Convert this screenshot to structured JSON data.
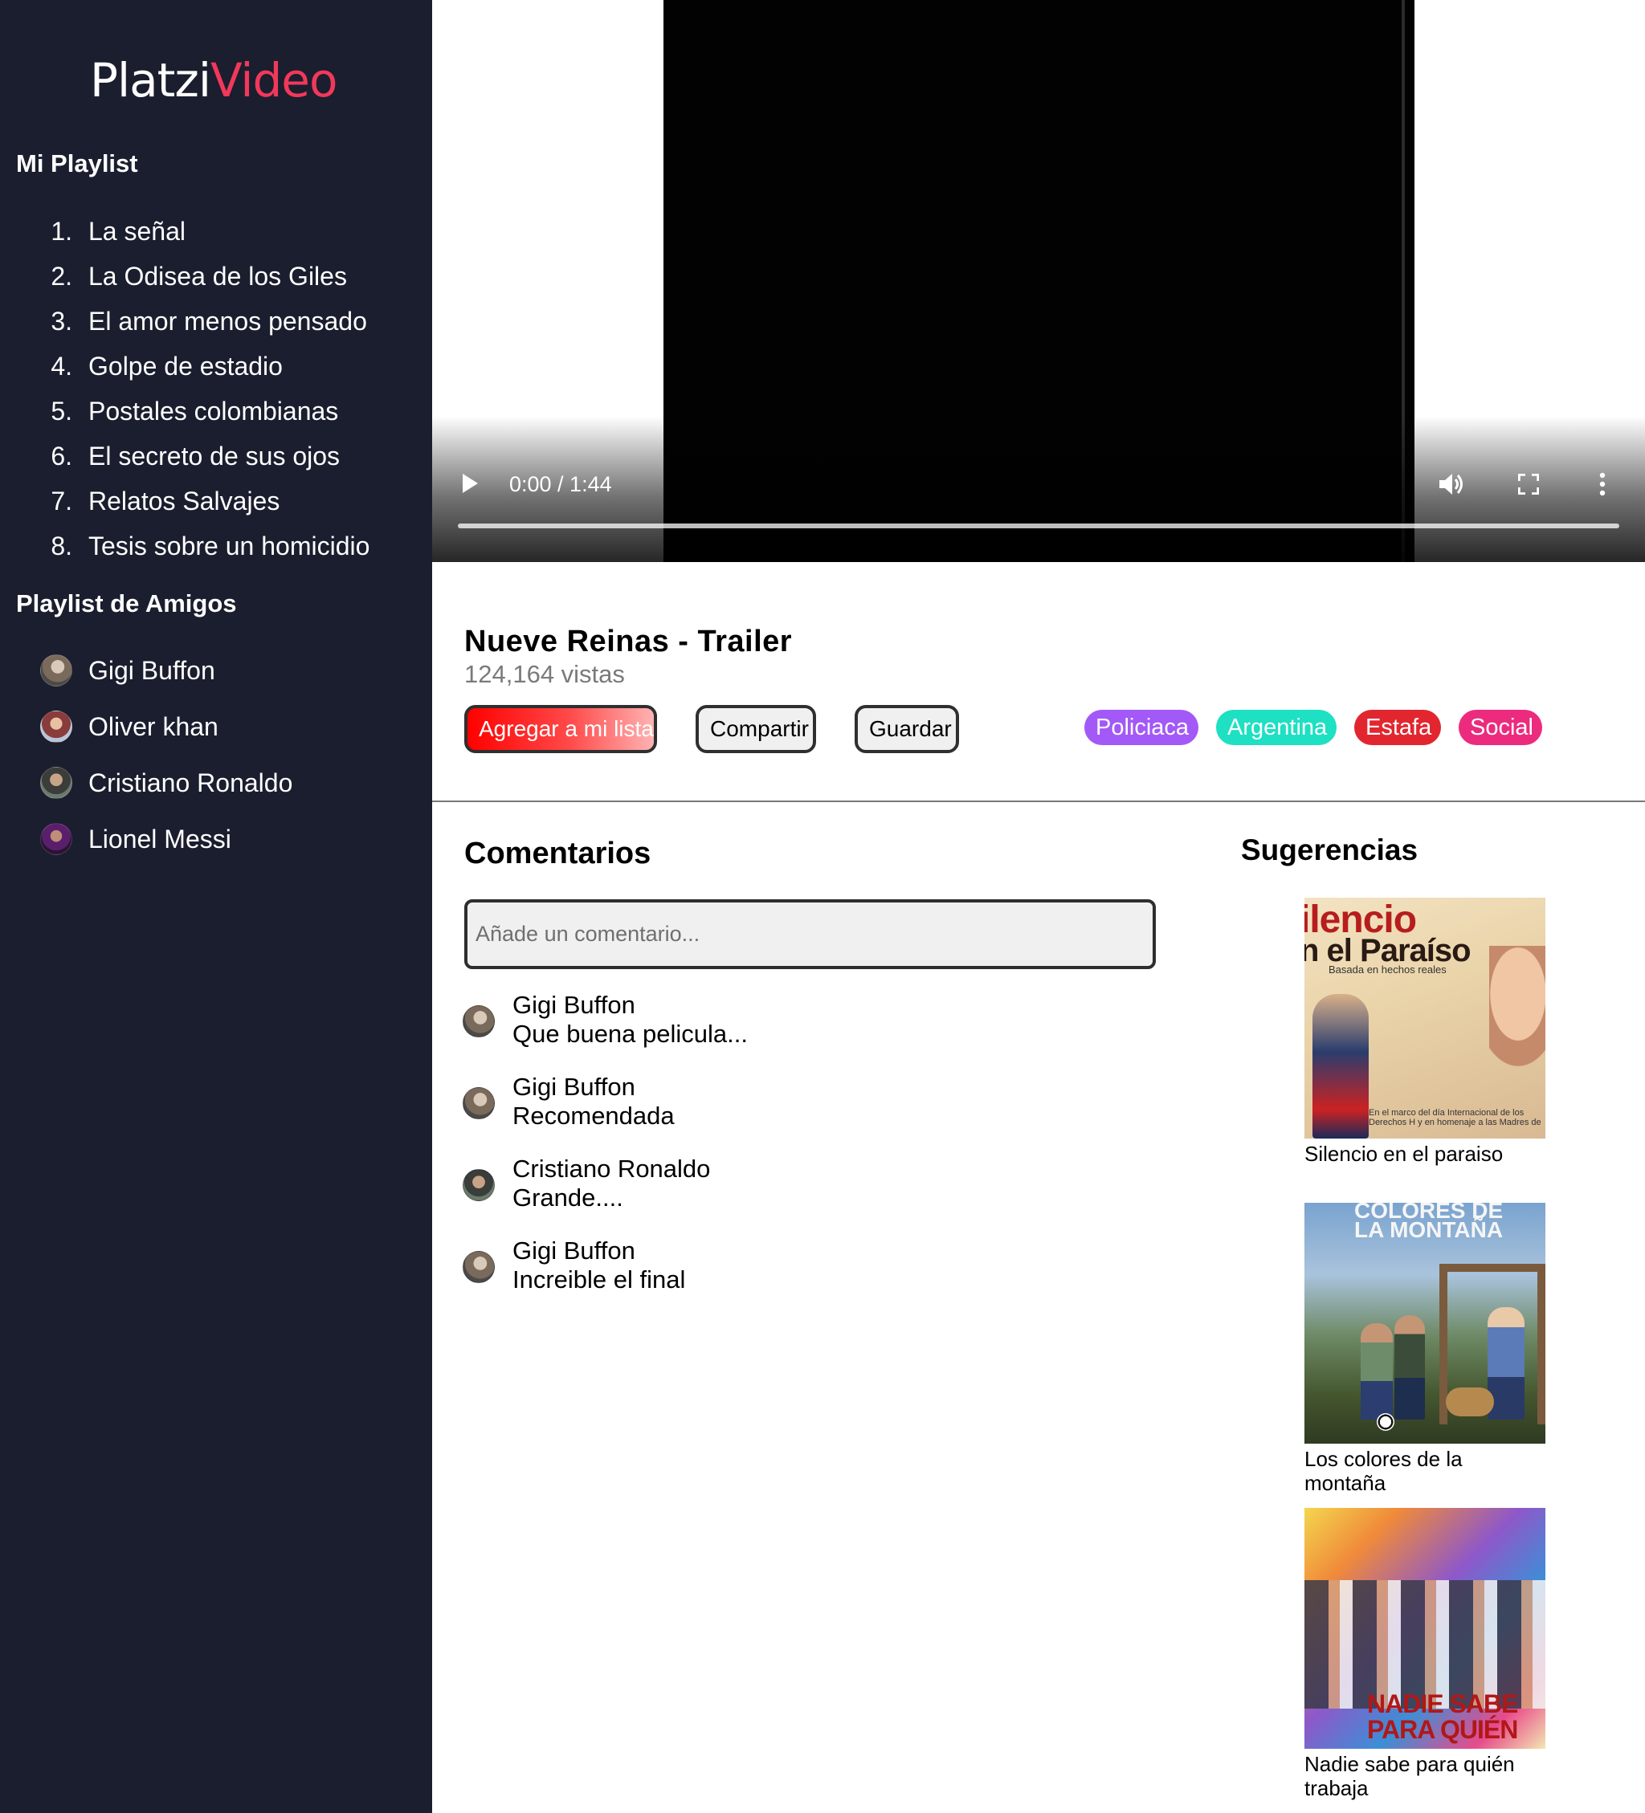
{
  "brand": {
    "part1": "Platzi",
    "part2": "Video"
  },
  "sidebar": {
    "playlist_title": "Mi Playlist",
    "playlist": [
      {
        "num": "1.",
        "title": "La señal"
      },
      {
        "num": "2.",
        "title": "La Odisea de los Giles"
      },
      {
        "num": "3.",
        "title": "El amor menos pensado"
      },
      {
        "num": "4.",
        "title": "Golpe de estadio"
      },
      {
        "num": "5.",
        "title": "Postales colombianas"
      },
      {
        "num": "6.",
        "title": "El secreto de sus ojos"
      },
      {
        "num": "7.",
        "title": "Relatos Salvajes"
      },
      {
        "num": "8.",
        "title": "Tesis sobre un homicidio"
      }
    ],
    "friends_title": "Playlist de Amigos",
    "friends": [
      {
        "name": "Gigi Buffon"
      },
      {
        "name": "Oliver khan"
      },
      {
        "name": "Cristiano Ronaldo"
      },
      {
        "name": "Lionel Messi"
      }
    ]
  },
  "player": {
    "time": "0:00 / 1:44",
    "progress_fraction": 0.0,
    "icons": [
      "play-icon",
      "volume-icon",
      "fullscreen-icon",
      "more-options-icon"
    ]
  },
  "video": {
    "title": "Nueve Reinas - Trailer",
    "views": "124,164 vistas",
    "buttons": {
      "add": "Agregar a mi lista",
      "share": "Compartir",
      "save": "Guardar"
    },
    "tags": [
      {
        "label": "Policiaca",
        "color": "#a259f7"
      },
      {
        "label": "Argentina",
        "color": "#1ee0c2"
      },
      {
        "label": "Estafa",
        "color": "#e2262f"
      },
      {
        "label": "Social",
        "color": "#ec2b7e"
      }
    ]
  },
  "comments": {
    "title": "Comentarios",
    "placeholder": "Añade un comentario...",
    "items": [
      {
        "author": "Gigi Buffon",
        "text": "Que buena pelicula..."
      },
      {
        "author": "Gigi Buffon",
        "text": "Recomendada"
      },
      {
        "author": "Cristiano Ronaldo",
        "text": "Grande...."
      },
      {
        "author": "Gigi Buffon",
        "text": "Increible el final"
      }
    ]
  },
  "suggestions": {
    "title": "Sugerencias",
    "items": [
      {
        "caption": "Silencio en el paraiso",
        "poster_text": [
          "ilencio",
          "n el Paraíso",
          "Basada en hechos reales",
          "En el marco del día Internacional de los Derechos H y en homenaje a las Madres de"
        ]
      },
      {
        "caption": "Los colores de la montaña",
        "poster_text": [
          "COLORES DE",
          "LA MONTAÑA"
        ]
      },
      {
        "caption": "Nadie sabe para quién trabaja",
        "poster_text": [
          "NADIE SABE",
          "PARA QUIÉN"
        ]
      }
    ]
  },
  "colors": {
    "sidebar_bg": "#1a1e2e",
    "brand_accent": "#f2385a",
    "add_button": "#ff0000"
  }
}
